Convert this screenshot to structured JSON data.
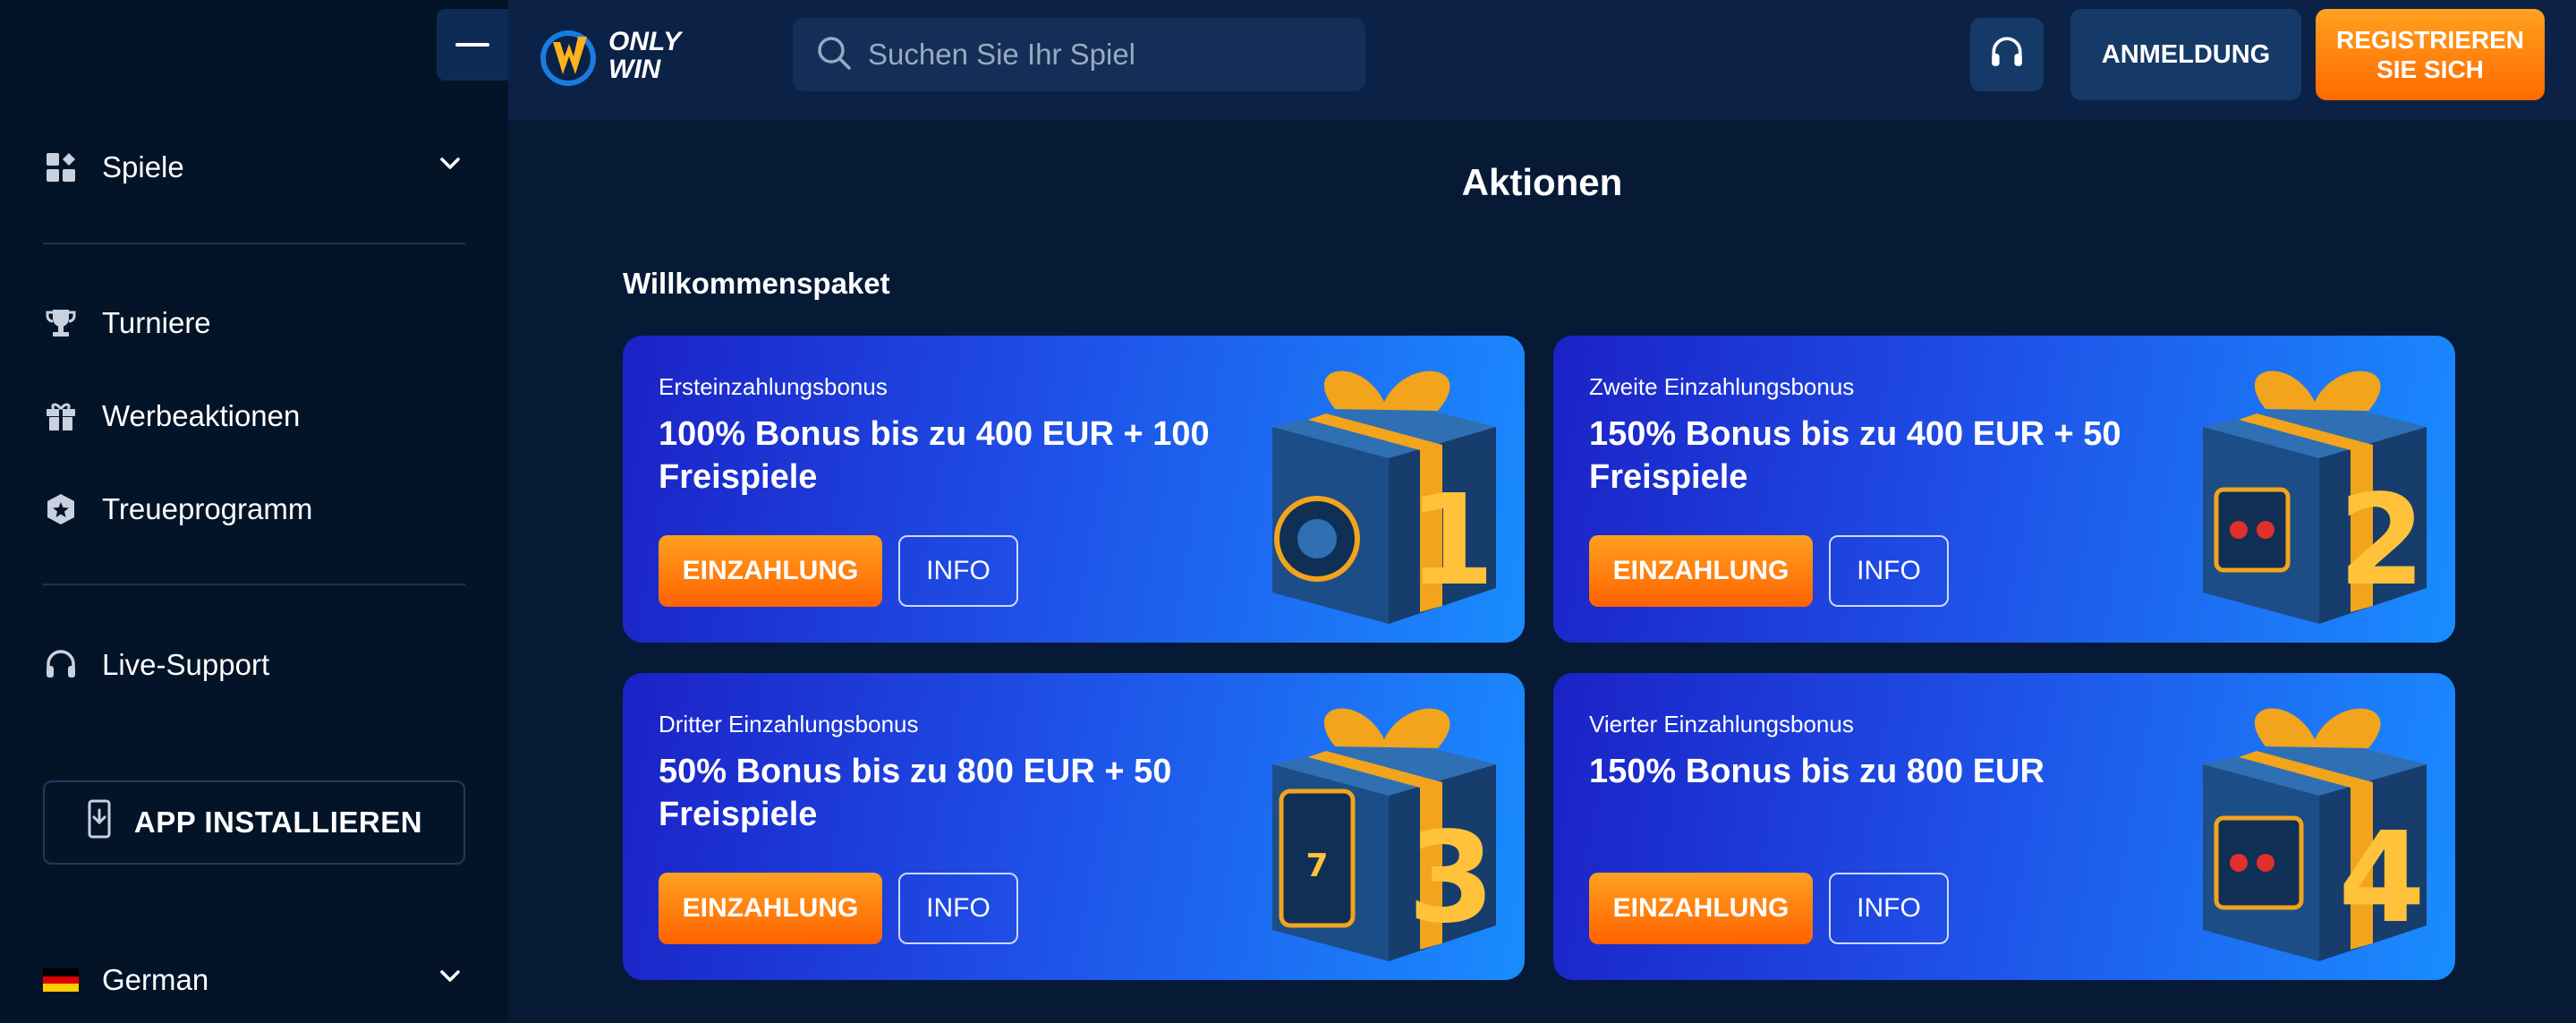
{
  "sidebar": {
    "items": [
      {
        "label": "Spiele"
      },
      {
        "label": "Turniere"
      },
      {
        "label": "Werbeaktionen"
      },
      {
        "label": "Treueprogramm"
      },
      {
        "label": "Live-Support"
      }
    ],
    "install_label": "APP INSTALLIEREN",
    "language_label": "German"
  },
  "header": {
    "logo_line1": "ONLY",
    "logo_line2": "WIN",
    "search_placeholder": "Suchen Sie Ihr Spiel",
    "login_label": "ANMELDUNG",
    "register_line1": "REGISTRIEREN",
    "register_line2": "SIE SICH"
  },
  "main": {
    "page_title": "Aktionen",
    "section_title": "Willkommenspaket",
    "cards": [
      {
        "subtitle": "Ersteinzahlungsbonus",
        "title": "100% Bonus bis zu 400 EUR + 100 Freispiele",
        "deposit_label": "EINZAHLUNG",
        "info_label": "INFO",
        "number": "1"
      },
      {
        "subtitle": "Zweite Einzahlungsbonus",
        "title": "150% Bonus bis zu 400 EUR + 50 Freispiele",
        "deposit_label": "EINZAHLUNG",
        "info_label": "INFO",
        "number": "2"
      },
      {
        "subtitle": "Dritter Einzahlungsbonus",
        "title": "50% Bonus bis zu 800 EUR + 50 Freispiele",
        "deposit_label": "EINZAHLUNG",
        "info_label": "INFO",
        "number": "3"
      },
      {
        "subtitle": "Vierter Einzahlungsbonus",
        "title": "150% Bonus bis zu 800 EUR",
        "deposit_label": "EINZAHLUNG",
        "info_label": "INFO",
        "number": "4"
      }
    ]
  },
  "colors": {
    "background": "#061a36",
    "sidebar": "#041428",
    "header": "#0b2246",
    "accent_orange": "#ff7a00",
    "card_blue": "#1f4ee6"
  },
  "icons": {
    "menu": "menu-dash-icon",
    "games": "grid-icon",
    "tournaments": "trophy-icon",
    "promotions": "gift-icon",
    "loyalty": "star-shield-icon",
    "support": "headset-icon",
    "install": "phone-download-icon",
    "language": "german-flag-icon",
    "search": "search-icon"
  }
}
